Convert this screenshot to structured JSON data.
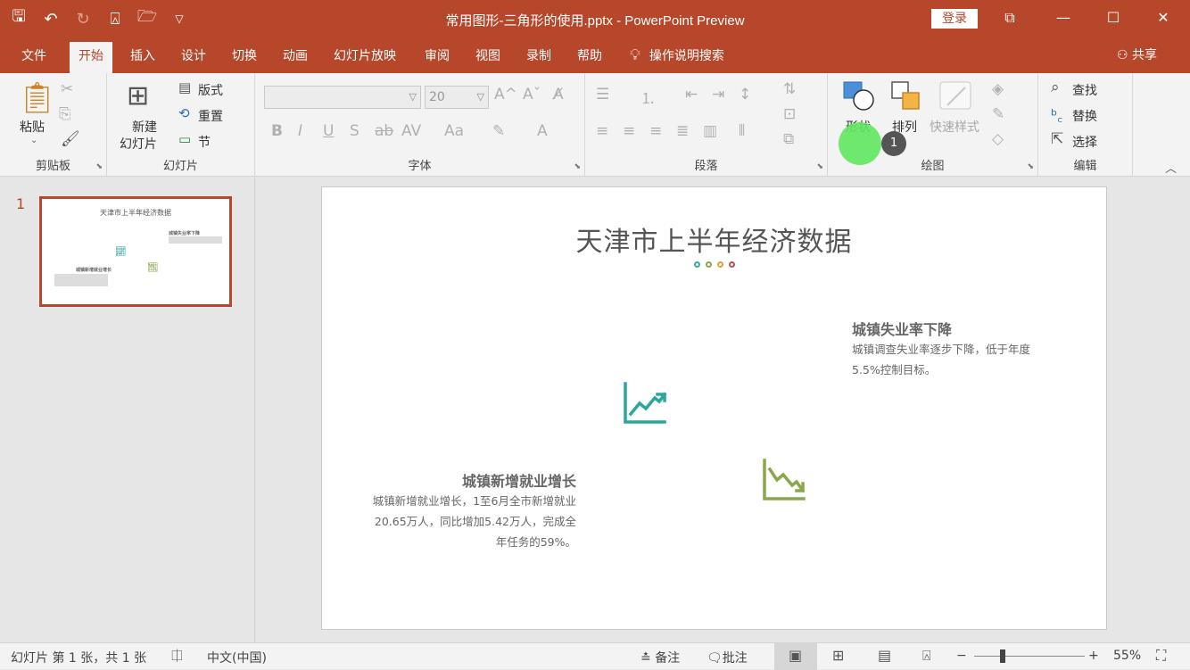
{
  "window": {
    "title": "常用图形-三角形的使用.pptx  -  PowerPoint Preview",
    "login_label": "登录",
    "qat_icons": [
      "save-icon",
      "undo-icon",
      "redo-icon",
      "present-icon",
      "open-icon",
      "customize-icon"
    ]
  },
  "tabs": [
    {
      "label": "文件"
    },
    {
      "label": "开始"
    },
    {
      "label": "插入"
    },
    {
      "label": "设计"
    },
    {
      "label": "切换"
    },
    {
      "label": "动画"
    },
    {
      "label": "幻灯片放映"
    },
    {
      "label": "审阅"
    },
    {
      "label": "视图"
    },
    {
      "label": "录制"
    },
    {
      "label": "帮助"
    }
  ],
  "tell_me": "操作说明搜索",
  "share": "共享",
  "ribbon": {
    "clipboard": {
      "label": "剪贴板",
      "paste": "粘贴"
    },
    "slides": {
      "label": "幻灯片",
      "new_slide_1": "新建",
      "new_slide_2": "幻灯片",
      "layout": "版式",
      "reset": "重置",
      "section": "节"
    },
    "font": {
      "label": "字体",
      "font_name": "",
      "font_size": "20"
    },
    "paragraph": {
      "label": "段落"
    },
    "drawing": {
      "label": "绘图",
      "shapes": "形状",
      "arrange": "排列",
      "quick_styles": "快速样式"
    },
    "editing": {
      "label": "编辑",
      "find": "查找",
      "replace": "替换",
      "select": "选择"
    }
  },
  "annotation_badge": "1",
  "thumbnail": {
    "number": "1"
  },
  "slide": {
    "title": "天津市上半年经济数据",
    "dots_colors": [
      "#3aa99a",
      "#8aa84a",
      "#e8a030",
      "#c0504d"
    ],
    "block_right": {
      "title": "城镇失业率下降",
      "lines": [
        "城镇调查失业率逐步下降，低于年度",
        "5.5%控制目标。"
      ]
    },
    "block_left": {
      "title": "城镇新增就业增长",
      "lines": [
        "城镇新增就业增长，1至6月全市新增就业",
        "20.65万人，同比增加5.42万人，完成全",
        "年任务的59%。"
      ]
    },
    "up_color": "#2aa79a",
    "down_color": "#8aa84a"
  },
  "status": {
    "slide_info": "幻灯片 第 1 张，共 1 张",
    "language": "中文(中国)",
    "notes": "备注",
    "comments": "批注",
    "zoom": "55%"
  }
}
